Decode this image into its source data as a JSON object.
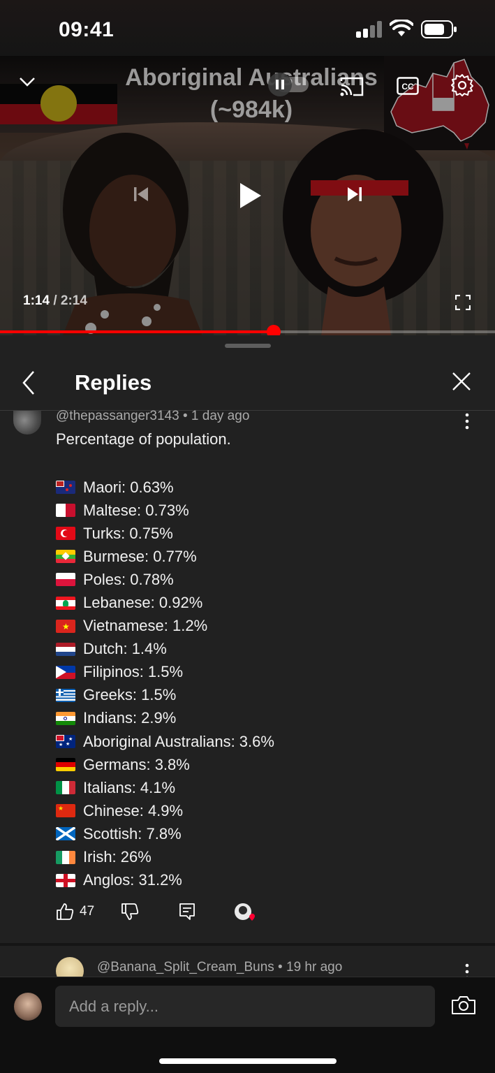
{
  "status_bar": {
    "time": "09:41"
  },
  "video": {
    "title": "Aboriginal Australians\n(~984k)",
    "current_time": "1:14",
    "duration": "2:14",
    "progress": 0.553,
    "accent": "#ff0000"
  },
  "panel": {
    "title": "Replies"
  },
  "comment": {
    "author": "@thepassanger3143",
    "age": "1 day ago",
    "intro": "Percentage of population.",
    "rows": [
      {
        "flag": "nz",
        "text": "Maori: 0.63%"
      },
      {
        "flag": "mt",
        "text": "Maltese: 0.73%"
      },
      {
        "flag": "tr",
        "text": "Turks: 0.75%"
      },
      {
        "flag": "mm",
        "text": "Burmese: 0.77%"
      },
      {
        "flag": "pl",
        "text": "Poles: 0.78%"
      },
      {
        "flag": "lb",
        "text": "Lebanese: 0.92%"
      },
      {
        "flag": "vn",
        "text": "Vietnamese: 1.2%"
      },
      {
        "flag": "nl",
        "text": "Dutch: 1.4%"
      },
      {
        "flag": "ph",
        "text": "Filipinos: 1.5%"
      },
      {
        "flag": "gr",
        "text": "Greeks: 1.5%"
      },
      {
        "flag": "in",
        "text": "Indians: 2.9%"
      },
      {
        "flag": "au",
        "text": "Aboriginal Australians: 3.6%"
      },
      {
        "flag": "de",
        "text": "Germans: 3.8%"
      },
      {
        "flag": "it",
        "text": "Italians: 4.1%"
      },
      {
        "flag": "cn",
        "text": "Chinese: 4.9%"
      },
      {
        "flag": "sco",
        "text": "Scottish: 7.8%"
      },
      {
        "flag": "ie",
        "text": "Irish: 26%"
      },
      {
        "flag": "eng",
        "text": "Anglos: 31.2%"
      }
    ],
    "likes": "47"
  },
  "next_comment": {
    "author": "@Banana_Split_Cream_Buns",
    "age": "19 hr ago"
  },
  "reply_bar": {
    "placeholder": "Add a reply..."
  }
}
